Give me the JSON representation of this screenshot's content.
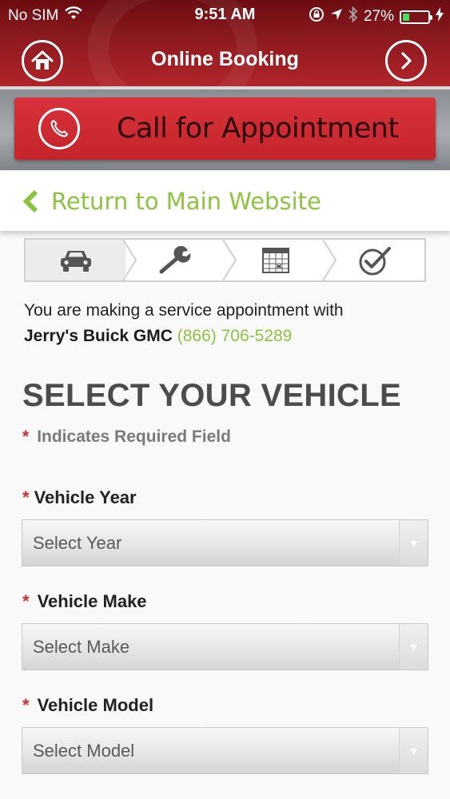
{
  "status_bar": {
    "carrier": "No SIM",
    "time": "9:51 AM",
    "battery_percent": "27%",
    "battery_level": 0.27
  },
  "nav": {
    "title": "Online Booking"
  },
  "call_banner": {
    "label": "Call for Appointment"
  },
  "return_link": {
    "label": "Return to Main Website"
  },
  "steps": {
    "icons": [
      "car-icon",
      "wrench-icon",
      "calendar-icon",
      "checkmark-icon"
    ],
    "active_index": 0
  },
  "intro": {
    "text": "You are making a service appointment with",
    "dealer": "Jerry's Buick GMC",
    "phone": "(866) 706-5289"
  },
  "form": {
    "title": "SELECT YOUR VEHICLE",
    "required_marker": "*",
    "required_note": "Indicates Required Field",
    "year": {
      "label": "Vehicle Year",
      "value": "Select Year"
    },
    "make": {
      "label": "Vehicle Make",
      "value": "Select Make"
    },
    "model": {
      "label": "Vehicle Model",
      "value": "Select Model"
    }
  },
  "colors": {
    "brand_red": "#c4242b",
    "accent_green": "#8cc43f",
    "required_red": "#d32f2f"
  }
}
